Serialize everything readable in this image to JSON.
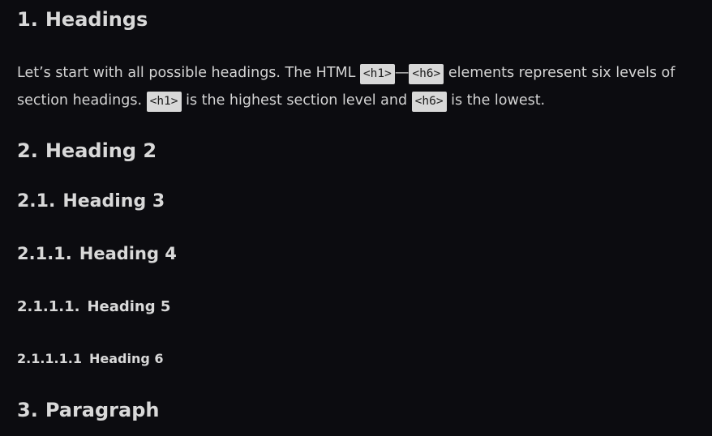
{
  "headings": [
    {
      "number": "1.",
      "text": "Headings"
    },
    {
      "number": "2.",
      "text": "Heading 2"
    },
    {
      "number": "2.1.",
      "text": "Heading 3"
    },
    {
      "number": "2.1.1.",
      "text": "Heading 4"
    },
    {
      "number": "2.1.1.1.",
      "text": "Heading 5"
    },
    {
      "number": "2.1.1.1.1",
      "text": "Heading 6"
    },
    {
      "number": "3.",
      "text": "Paragraph"
    }
  ],
  "paragraph": {
    "part1": "Let’s start with all possible headings. The HTML ",
    "code1": "<h1>",
    "part2": "—",
    "code2": "<h6>",
    "part3": " elements represent six levels of section headings. ",
    "code3": "<h1>",
    "part4": " is the highest section level and ",
    "code4": "<h6>",
    "part5": " is the lowest."
  }
}
